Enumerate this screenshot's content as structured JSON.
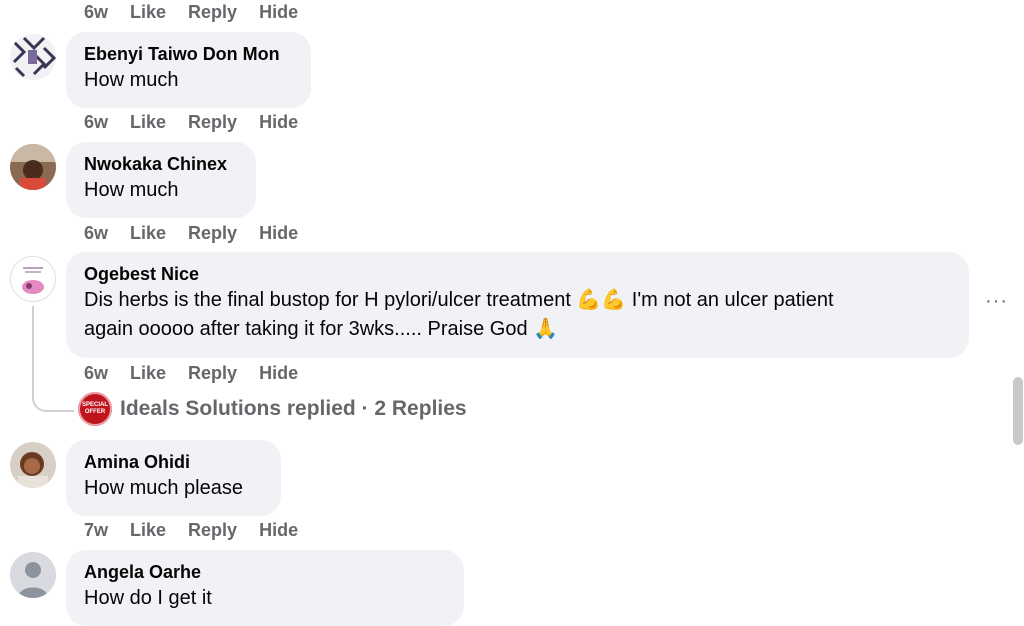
{
  "comments": [
    {
      "actions": {
        "time": "6w",
        "like": "Like",
        "reply": "Reply",
        "hide": "Hide"
      }
    },
    {
      "name": "Ebenyi Taiwo Don Mon",
      "text": "How much",
      "actions": {
        "time": "6w",
        "like": "Like",
        "reply": "Reply",
        "hide": "Hide"
      }
    },
    {
      "name": "Nwokaka Chinex",
      "text": "How much",
      "actions": {
        "time": "6w",
        "like": "Like",
        "reply": "Reply",
        "hide": "Hide"
      }
    },
    {
      "name": "Ogebest Nice",
      "text_line1": "Dis herbs is the final bustop for H pylori/ulcer treatment 💪💪 I'm not an ulcer patient",
      "text_line2": "again ooooo after taking it for 3wks..... Praise God 🙏",
      "actions": {
        "time": "6w",
        "like": "Like",
        "reply": "Reply",
        "hide": "Hide"
      },
      "replies": {
        "badge": "SPECIAL OFFER",
        "label": "Ideals Solutions replied · 2 Replies"
      },
      "more": "···"
    },
    {
      "name": "Amina Ohidi",
      "text": "How much please",
      "actions": {
        "time": "7w",
        "like": "Like",
        "reply": "Reply",
        "hide": "Hide"
      }
    },
    {
      "name": "Angela Oarhe",
      "text": "How do I get it"
    }
  ],
  "colors": {
    "bubble": "#f0f2f5",
    "meta": "#65676b",
    "text": "#050505",
    "badge": "#c0141c"
  }
}
